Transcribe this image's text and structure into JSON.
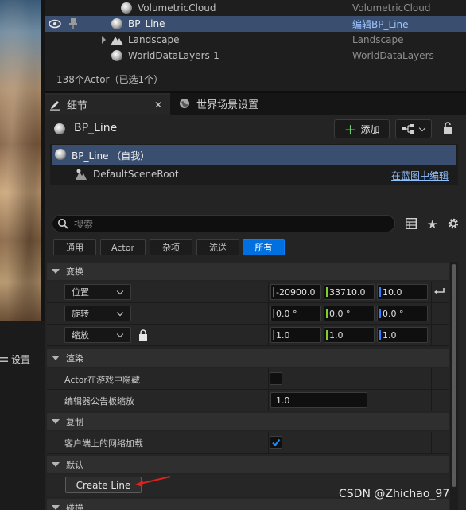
{
  "left_panel": {
    "settings_label": "设置"
  },
  "outliner": {
    "rows": [
      {
        "name": "VolumetricCloud",
        "type": "VolumetricCloud"
      },
      {
        "name": "BP_Line",
        "type": "编辑BP_Line"
      },
      {
        "name": "Landscape",
        "type": "Landscape"
      },
      {
        "name": "WorldDataLayers-1",
        "type": "WorldDataLayers"
      }
    ],
    "actor_count": "138个Actor（已选1个）"
  },
  "tabs": {
    "details": "细节",
    "world_settings": "世界场景设置"
  },
  "details": {
    "actor_name": "BP_Line",
    "add_button": "添加",
    "components": {
      "self": "BP_Line （自我）",
      "root": "DefaultSceneRoot",
      "edit_link": "在蓝图中编辑"
    },
    "search_placeholder": "搜索",
    "filters": [
      "通用",
      "Actor",
      "杂项",
      "流送",
      "所有"
    ],
    "sections": {
      "transform": "变换",
      "rendering": "渲染",
      "replication": "复制",
      "default": "默认",
      "collision": "碰撞"
    },
    "transform": {
      "location_label": "位置",
      "location": [
        "-20900.0",
        "33710.0",
        "10.0"
      ],
      "rotation_label": "旋转",
      "rotation": [
        "0.0 °",
        "0.0 °",
        "0.0 °"
      ],
      "scale_label": "缩放",
      "scale": [
        "1.0",
        "1.0",
        "1.0"
      ]
    },
    "rendering": {
      "hidden_in_game_label": "Actor在游戏中隐藏",
      "billboard_scale_label": "编辑器公告板缩放",
      "billboard_scale": "1.0"
    },
    "replication": {
      "net_load_label": "客户端上的网络加载",
      "net_load_checked": true
    },
    "default": {
      "create_line_button": "Create Line"
    }
  },
  "colors": {
    "accent": "#0070e0",
    "x_axis": "#e02c2c",
    "y_axis": "#7fcf2f",
    "z_axis": "#2f7fff",
    "annotation_arrow": "#e0201c"
  },
  "watermark": "CSDN @Zhichao_97"
}
